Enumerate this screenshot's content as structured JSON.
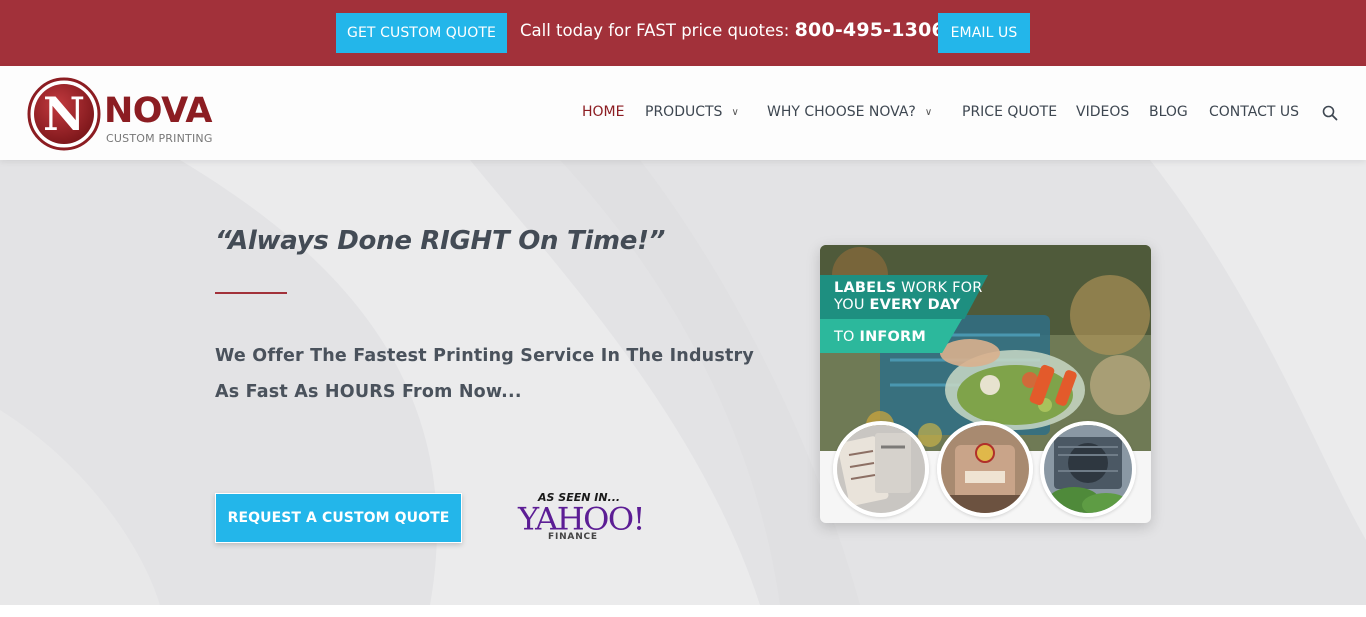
{
  "topbar": {
    "quote_button": "GET CUSTOM QUOTE",
    "call_text": "Call today for FAST price quotes: ",
    "phone": "800-495-1306",
    "email_button": "EMAIL US"
  },
  "header": {
    "logo_letter": "N",
    "logo_word": "NOVA",
    "logo_sub": "CUSTOM PRINTING",
    "nav": [
      {
        "label": "HOME",
        "active": true
      },
      {
        "label": "PRODUCTS",
        "has_dropdown": true
      },
      {
        "label": "WHY CHOOSE NOVA?",
        "has_dropdown": true
      },
      {
        "label": "PRICE QUOTE"
      },
      {
        "label": "VIDEOS"
      },
      {
        "label": "BLOG"
      },
      {
        "label": "CONTACT US"
      }
    ],
    "search_icon": "search-icon"
  },
  "hero": {
    "tagline": "“Always Done RIGHT On Time!”",
    "lead_line1": "We Offer The Fastest Printing Service In The Industry",
    "lead_line2": "As Fast As HOURS From Now...",
    "cta_button": "REQUEST A CUSTOM QUOTE",
    "press": {
      "seen_in": "AS SEEN IN...",
      "brand": "YAHOO!",
      "brand_sub": "FINANCE"
    },
    "promo": {
      "banner_line1_a": "LABELS",
      "banner_line1_b": " WORK FOR",
      "banner_line2_a": "YOU ",
      "banner_line2_b": "EVERY DAY",
      "banner_line3_a": "TO ",
      "banner_line3_b": "INFORM"
    }
  },
  "colors": {
    "brand_red": "#a2313a",
    "accent_blue": "#23b6ea",
    "logo_red": "#8c1d22",
    "text_dark": "#434b55",
    "yahoo_purple": "#5c1d95"
  }
}
